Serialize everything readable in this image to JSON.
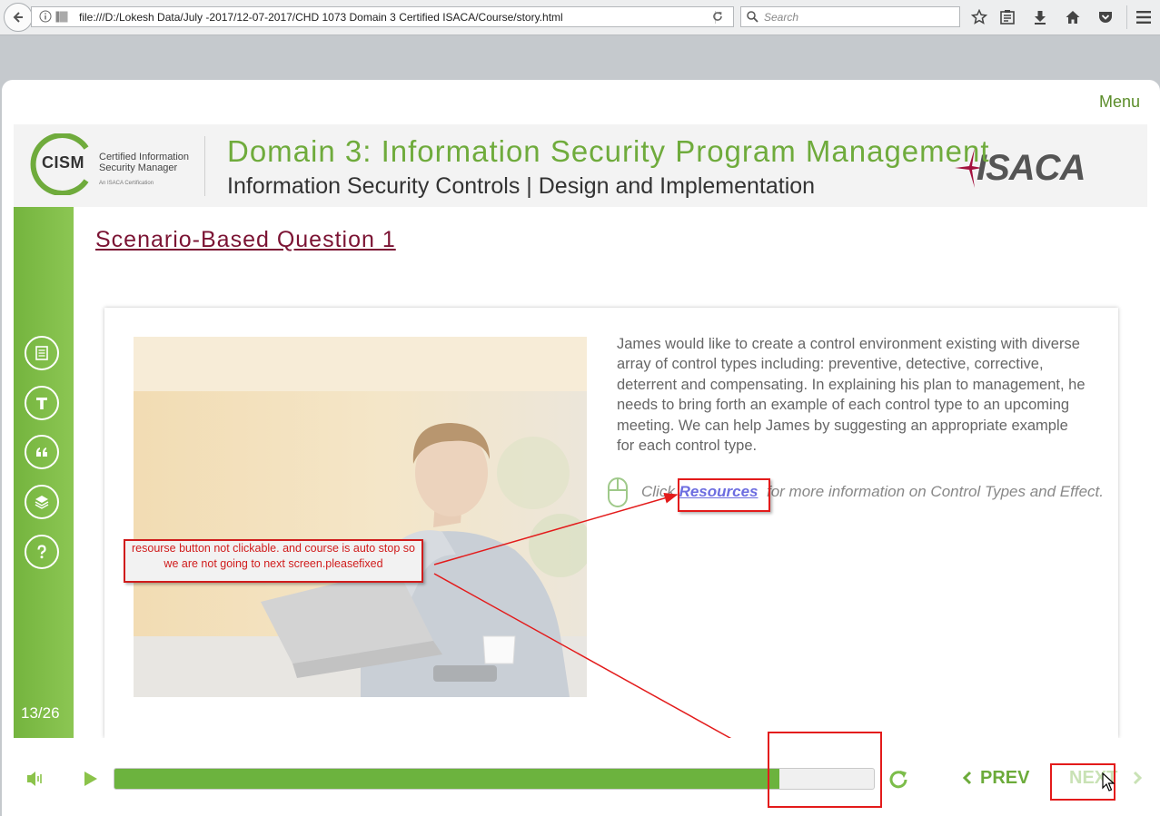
{
  "browser": {
    "url": "file:///D:/Lokesh Data/July -2017/12-07-2017/CHD 1073 Domain 3 Certified ISACA/Course/story.html",
    "search_placeholder": "Search"
  },
  "course": {
    "menu_label": "Menu",
    "cism_logo": {
      "acronym": "CISM",
      "line1": "Certified Information",
      "line2": "Security Manager",
      "subline": "An ISACA Certification"
    },
    "domain_title": "Domain 3: Information Security Program Management",
    "subtitle": "Information Security Controls | Design and Implementation",
    "isaca_logo": "ISACA",
    "page_indicator": "13/26"
  },
  "slide": {
    "title": "Scenario-Based Question 1",
    "paragraph": "James would like to create a control environment existing with diverse array of control types including: preventive, detective, corrective, deterrent and compensating. In explaining his plan to management, he needs to bring forth an example of each control type to an upcoming meeting. We can help James by suggesting an appropriate example for each control type.",
    "click_prefix": "Click",
    "resources_link": "Resources",
    "click_suffix": "for more information on Control Types and Effect."
  },
  "annotation": {
    "note": "resourse button not clickable. and course is auto stop so we are not going to next screen.pleasefixed"
  },
  "player": {
    "progress_fraction": 0.875,
    "prev_label": "PREV",
    "next_label": "NEXT"
  },
  "colors": {
    "brand_green": "#6fab3c",
    "title_maroon": "#7b1333",
    "annotation_red": "#e31b1b"
  }
}
